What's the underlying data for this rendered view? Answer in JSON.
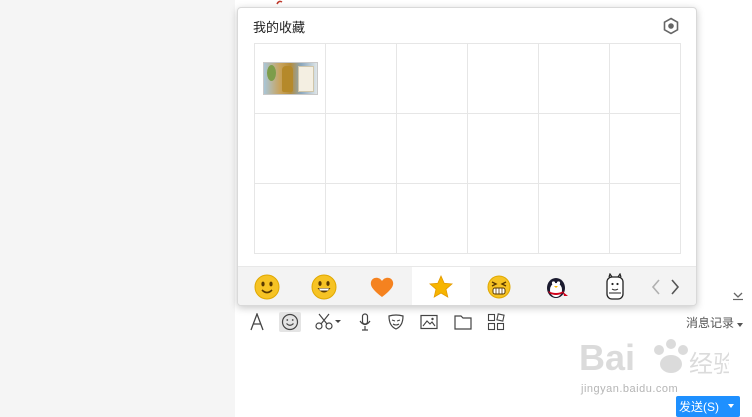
{
  "popup": {
    "title": "我的收藏"
  },
  "tabs": [
    {
      "icon": "smiley-face-icon"
    },
    {
      "icon": "grinning-face-icon"
    },
    {
      "icon": "heart-icon"
    },
    {
      "icon": "star-icon",
      "active": true
    },
    {
      "icon": "laughing-face-icon"
    },
    {
      "icon": "penguin-icon"
    },
    {
      "icon": "bear-sticker-icon"
    }
  ],
  "toolbar": {
    "history_label": "消息记录"
  },
  "send": {
    "label": "发送(S)"
  },
  "watermark": {
    "logo_text": "Bai 经验",
    "url": "jingyan.baidu.com"
  },
  "colors": {
    "accent": "#1e90ff",
    "heart": "#f5821f",
    "star": "#f7b500",
    "emoji": "#f6c324"
  }
}
